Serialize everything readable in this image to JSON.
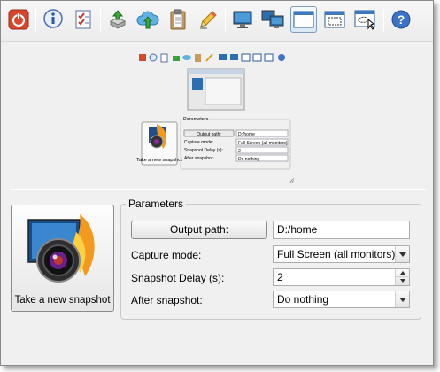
{
  "toolbar": {
    "items": [
      {
        "icon": "power-icon"
      },
      {
        "icon": "info-icon"
      },
      {
        "icon": "checklist-icon"
      },
      {
        "icon": "install-icon"
      },
      {
        "icon": "cloud-upload-icon"
      },
      {
        "icon": "clipboard-icon"
      },
      {
        "icon": "pencil-icon"
      },
      {
        "icon": "monitor-icon"
      },
      {
        "icon": "multi-monitor-icon"
      },
      {
        "icon": "window-icon"
      },
      {
        "icon": "region-icon"
      },
      {
        "icon": "freehand-region-icon"
      },
      {
        "icon": "help-icon"
      }
    ],
    "active_item": "window-icon"
  },
  "preview": {
    "output_path_label": "Output path:",
    "output_path_value": "D:/home",
    "capture_mode_label": "Capture mode:",
    "capture_mode_value": "Full Screen (all monitors)",
    "delay_label": "Snapshot Delay (s):",
    "delay_value": "2",
    "after_label": "After snapshot:",
    "after_value": "Do nothing",
    "group_title": "Parameters",
    "snap_label": "Take a new snapshot"
  },
  "main": {
    "snapshot_button_label": "Take a new snapshot",
    "parameters_title": "Parameters",
    "output_path_button": "Output path:",
    "output_path_value": "D:/home",
    "capture_mode_label": "Capture mode:",
    "capture_mode_value": "Full Screen (all monitors)",
    "delay_label": "Snapshot Delay (s):",
    "delay_value": "2",
    "after_snapshot_label": "After snapshot:",
    "after_snapshot_value": "Do nothing"
  }
}
